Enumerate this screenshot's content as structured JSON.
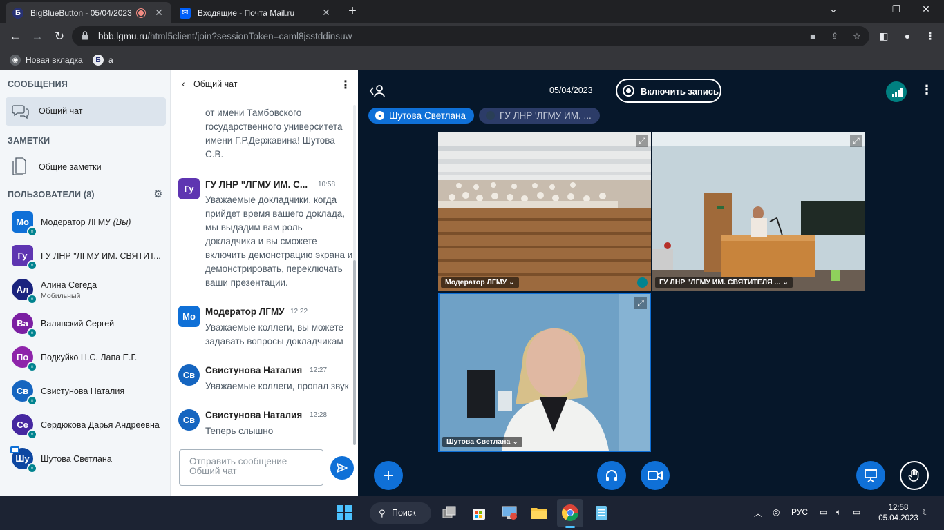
{
  "browser": {
    "tabs": [
      {
        "title": "BigBlueButton - 05/04/2023",
        "favicon": "Б",
        "active": true
      },
      {
        "title": "Входящие - Почта Mail.ru",
        "favicon": "✉",
        "active": false
      }
    ],
    "address": {
      "host": "bbb.lgmu.ru",
      "path": "/html5client/join?sessionToken=caml8jsstddinsuw"
    },
    "bookmarks": [
      {
        "label": "Новая вкладка"
      },
      {
        "label": "а"
      }
    ]
  },
  "sidebar": {
    "messages_title": "СООБЩЕНИЯ",
    "public_chat": "Общий чат",
    "notes_title": "ЗАМЕТКИ",
    "shared_notes": "Общие заметки",
    "users_title": "ПОЛЬЗОВАТЕЛИ (8)",
    "users": [
      {
        "initials": "Мо",
        "name": "Модератор ЛГМУ",
        "suffix": "(Вы)",
        "sub": "",
        "color": "#0f70d7",
        "moderator": true
      },
      {
        "initials": "Гу",
        "name": "ГУ ЛНР \"ЛГМУ ИМ. СВЯТИТ...",
        "suffix": "",
        "sub": "",
        "color": "#5e35b1",
        "moderator": true
      },
      {
        "initials": "Ал",
        "name": "Алина Сегеда",
        "suffix": "",
        "sub": "Мобильный",
        "color": "#1a237e",
        "moderator": false
      },
      {
        "initials": "Ва",
        "name": "Валявский Сергей",
        "suffix": "",
        "sub": "",
        "color": "#7b1fa2",
        "moderator": false
      },
      {
        "initials": "По",
        "name": "Подкуйко Н.С. Лапа Е.Г.",
        "suffix": "",
        "sub": "",
        "color": "#8e24aa",
        "moderator": false
      },
      {
        "initials": "Св",
        "name": "Свистунова Наталия",
        "suffix": "",
        "sub": "",
        "color": "#1565c0",
        "moderator": false
      },
      {
        "initials": "Се",
        "name": "Сердюкова Дарья Андреевна",
        "suffix": "",
        "sub": "",
        "color": "#4527a0",
        "moderator": false
      },
      {
        "initials": "Шу",
        "name": "Шутова Светлана",
        "suffix": "",
        "sub": "",
        "color": "#0d47a1",
        "moderator": false
      }
    ]
  },
  "chat": {
    "title": "Общий чат",
    "partial_text": "от имени Тамбовского государственного университета имени Г.Р.Державина! Шутова С.В.",
    "messages": [
      {
        "initials": "Гу",
        "author": "ГУ ЛНР \"ЛГМУ ИМ. С...",
        "time": "10:58",
        "text": "Уважаемые докладчики, когда прийдет время вашего доклада, мы выдадим вам роль докладчика и вы сможете включить демонстрацию экрана и демонстрировать, переключать ваши презентации.",
        "color": "#5e35b1"
      },
      {
        "initials": "Мо",
        "author": "Модератор ЛГМУ",
        "time": "12:22",
        "text": "Уважаемые коллеги, вы можете задавать вопросы докладчикам",
        "color": "#0f70d7"
      },
      {
        "initials": "Св",
        "author": "Свистунова Наталия",
        "time": "12:27",
        "text": "Уважаемые коллеги, пропал звук",
        "color": "#1565c0"
      },
      {
        "initials": "Св",
        "author": "Свистунова Наталия",
        "time": "12:28",
        "text": "Теперь слышно",
        "color": "#1565c0"
      }
    ],
    "input_placeholder": "Отправить сообщение Общий чат"
  },
  "meeting": {
    "date": "05/04/2023",
    "record_label": "Включить запись",
    "talkers": [
      "Шутова Светлана",
      "ГУ ЛНР 'ЛГМУ ИМ. ..."
    ],
    "videos": [
      {
        "name": "Модератор ЛГМУ"
      },
      {
        "name": "ГУ ЛНР \"ЛГМУ ИМ. СВЯТИТЕЛЯ ..."
      },
      {
        "name": "Шутова Светлана"
      }
    ]
  },
  "taskbar": {
    "search_label": "Поиск",
    "lang": "РУС",
    "time": "12:58",
    "date": "05.04.2023"
  }
}
